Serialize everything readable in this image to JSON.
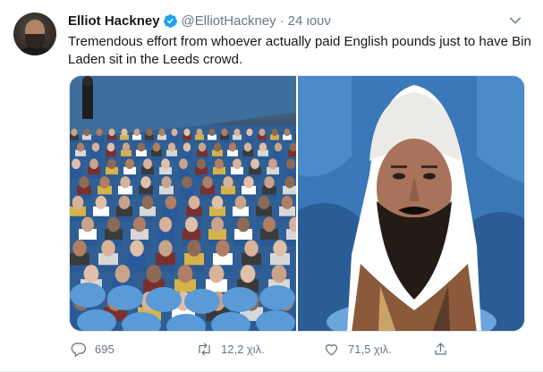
{
  "tweet": {
    "author_name": "Elliot Hackney",
    "author_handle": "@ElliotHackney",
    "separator": "·",
    "timestamp": "24 ιουν",
    "verified": true,
    "text": "Tremendous effort from whoever actually paid English pounds just to have Bin Laden sit in the Leeds crowd.",
    "media": [
      {
        "name": "stadium-cutouts-photo"
      },
      {
        "name": "bin-laden-cutout-photo"
      }
    ]
  },
  "actions": {
    "reply_count": "695",
    "retweet_count": "12,2 χιλ.",
    "like_count": "71,5 χιλ.",
    "share_label": ""
  },
  "icons": {
    "verified": "verified-badge-icon",
    "caret": "chevron-down-icon",
    "reply": "comment-icon",
    "retweet": "retweet-icon",
    "like": "heart-icon",
    "share": "share-icon"
  },
  "colors": {
    "text": "#14171a",
    "muted": "#657786",
    "verified": "#1da1f2",
    "seat_blue": "#3f7fc4"
  }
}
